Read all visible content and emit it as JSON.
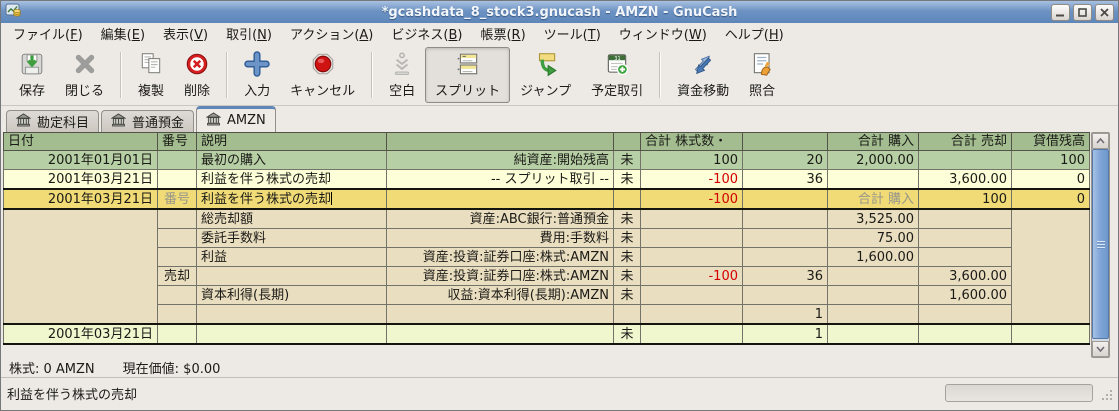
{
  "window": {
    "title": "*gcashdata_8_stock3.gnucash - AMZN - GnuCash"
  },
  "menu": {
    "items": [
      {
        "pre": "ファイル(",
        "key": "F",
        "post": ")"
      },
      {
        "pre": "編集(",
        "key": "E",
        "post": ")"
      },
      {
        "pre": "表示(",
        "key": "V",
        "post": ")"
      },
      {
        "pre": "取引(",
        "key": "N",
        "post": ")"
      },
      {
        "pre": "アクション(",
        "key": "A",
        "post": ")"
      },
      {
        "pre": "ビジネス(",
        "key": "B",
        "post": ")"
      },
      {
        "pre": "帳票(",
        "key": "R",
        "post": ")"
      },
      {
        "pre": "ツール(",
        "key": "T",
        "post": ")"
      },
      {
        "pre": "ウィンドウ(",
        "key": "W",
        "post": ")"
      },
      {
        "pre": "ヘルプ(",
        "key": "H",
        "post": ")"
      }
    ]
  },
  "toolbar": {
    "buttons": [
      {
        "label": "保存",
        "icon": "save-icon"
      },
      {
        "label": "閉じる",
        "icon": "close-icon"
      },
      {
        "label": "複製",
        "icon": "duplicate-icon"
      },
      {
        "label": "削除",
        "icon": "delete-icon"
      },
      {
        "label": "入力",
        "icon": "enter-icon"
      },
      {
        "label": "キャンセル",
        "icon": "cancel-icon"
      },
      {
        "label": "空白",
        "icon": "blank-icon"
      },
      {
        "label": "スプリット",
        "icon": "split-icon",
        "active": true
      },
      {
        "label": "ジャンプ",
        "icon": "jump-icon"
      },
      {
        "label": "予定取引",
        "icon": "scheduled-icon"
      },
      {
        "label": "資金移動",
        "icon": "transfer-icon"
      },
      {
        "label": "照合",
        "icon": "reconcile-icon"
      }
    ]
  },
  "tabs": {
    "items": [
      {
        "label": "勘定科目"
      },
      {
        "label": "普通預金"
      },
      {
        "label": "AMZN",
        "active": true
      }
    ]
  },
  "register": {
    "headers": [
      "日付",
      "番号",
      "説明",
      "",
      "",
      "合計 株式数・",
      "",
      "合計 購入",
      "合計 売却",
      "貸借残高"
    ],
    "rows": [
      {
        "date": "2001年01月01日",
        "num": "",
        "desc": "最初の購入",
        "xfer": "純資産:開始残高",
        "rec": "未",
        "shares": "100",
        "price": "20",
        "buy": "2,000.00",
        "sell": "",
        "bal": "100"
      },
      {
        "date": "2001年03月21日",
        "num": "",
        "desc": "利益を伴う株式の売却",
        "xfer": "-- スプリット取引 --",
        "rec": "未",
        "shares": "-100",
        "price": "36",
        "buy": "",
        "sell": "3,600.00",
        "bal": "0"
      },
      {
        "date": "2001年03月21日",
        "num": "番号",
        "desc": "利益を伴う株式の売却",
        "xfer": "",
        "rec": "",
        "shares": "-100",
        "price": "",
        "buy": "合計 購入",
        "sell": "100",
        "bal": "0"
      },
      {
        "num": "",
        "desc": "総売却額",
        "xfer": "資産:ABC銀行:普通預金",
        "rec": "未",
        "shares": "",
        "price": "",
        "buy": "3,525.00",
        "sell": ""
      },
      {
        "num": "",
        "desc": "委託手数料",
        "xfer": "費用:手数料",
        "rec": "未",
        "shares": "",
        "price": "",
        "buy": "75.00",
        "sell": ""
      },
      {
        "num": "",
        "desc": "利益",
        "xfer": "資産:投資:証券口座:株式:AMZN",
        "rec": "未",
        "shares": "",
        "price": "",
        "buy": "1,600.00",
        "sell": ""
      },
      {
        "num": "売却",
        "desc": "",
        "xfer": "資産:投資:証券口座:株式:AMZN",
        "rec": "未",
        "shares": "-100",
        "price": "36",
        "buy": "",
        "sell": "3,600.00"
      },
      {
        "num": "",
        "desc": "資本利得(長期)",
        "xfer": "収益:資本利得(長期):AMZN",
        "rec": "未",
        "shares": "",
        "price": "",
        "buy": "",
        "sell": "1,600.00"
      },
      {
        "num": "",
        "desc": "",
        "xfer": "",
        "rec": "",
        "shares": "",
        "price": "1",
        "buy": "",
        "sell": ""
      },
      {
        "date": "2001年03月21日",
        "num": "",
        "desc": "",
        "xfer": "",
        "rec": "未",
        "shares": "",
        "price": "1",
        "buy": "",
        "sell": "",
        "bal": ""
      }
    ]
  },
  "summary": {
    "shares": "株式: 0 AMZN",
    "value": "現在価値: $0.00"
  },
  "status": {
    "text": "利益を伴う株式の売却"
  },
  "colors": {
    "titlebar": "#6d93c4",
    "header_row": "#a3bd90",
    "tx_green": "#b7cfa5",
    "tx_yellow": "#fcffd8",
    "selected_row": "#f0db76",
    "split_row": "#eadec0",
    "blank_row": "#f0f7cf",
    "negative": "#d40000",
    "scrollbar_thumb": "#7fa5d6"
  }
}
